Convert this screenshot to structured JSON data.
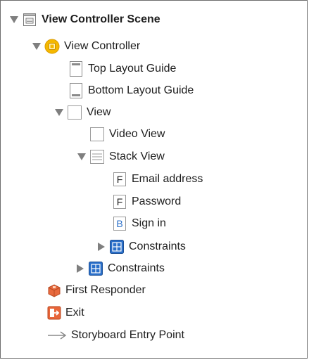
{
  "outline": {
    "scene": {
      "label": "View Controller Scene",
      "icon": "scene-icon"
    },
    "view_controller": {
      "label": "View Controller",
      "icon": "view-controller-icon"
    },
    "top_layout_guide": {
      "label": "Top Layout Guide",
      "icon": "top-layout-guide-icon"
    },
    "bottom_layout_guide": {
      "label": "Bottom Layout Guide",
      "icon": "bottom-layout-guide-icon"
    },
    "view": {
      "label": "View",
      "icon": "view-icon"
    },
    "video_view": {
      "label": "Video View",
      "icon": "view-icon"
    },
    "stack_view": {
      "label": "Stack View",
      "icon": "stack-view-icon"
    },
    "email_field": {
      "label": "Email address",
      "badge": "F",
      "icon": "text-field-icon"
    },
    "password_field": {
      "label": "Password",
      "badge": "F",
      "icon": "text-field-icon"
    },
    "sign_in_button": {
      "label": "Sign in",
      "badge": "B",
      "icon": "button-icon"
    },
    "stack_constraints": {
      "label": "Constraints",
      "icon": "constraints-icon"
    },
    "view_constraints": {
      "label": "Constraints",
      "icon": "constraints-icon"
    },
    "first_responder": {
      "label": "First Responder",
      "icon": "first-responder-icon"
    },
    "exit": {
      "label": "Exit",
      "icon": "exit-icon"
    },
    "entry_point": {
      "label": "Storyboard Entry Point",
      "icon": "arrow-right-icon"
    }
  },
  "colors": {
    "text": "#1e1e1e",
    "disclosure": "#7f7f7f",
    "constraints_blue": "#2a6fc9",
    "vc_yellow": "#f5b800",
    "exit_orange": "#e8663a",
    "responder_orange": "#e8693d",
    "button_blue": "#2a6fc9"
  }
}
